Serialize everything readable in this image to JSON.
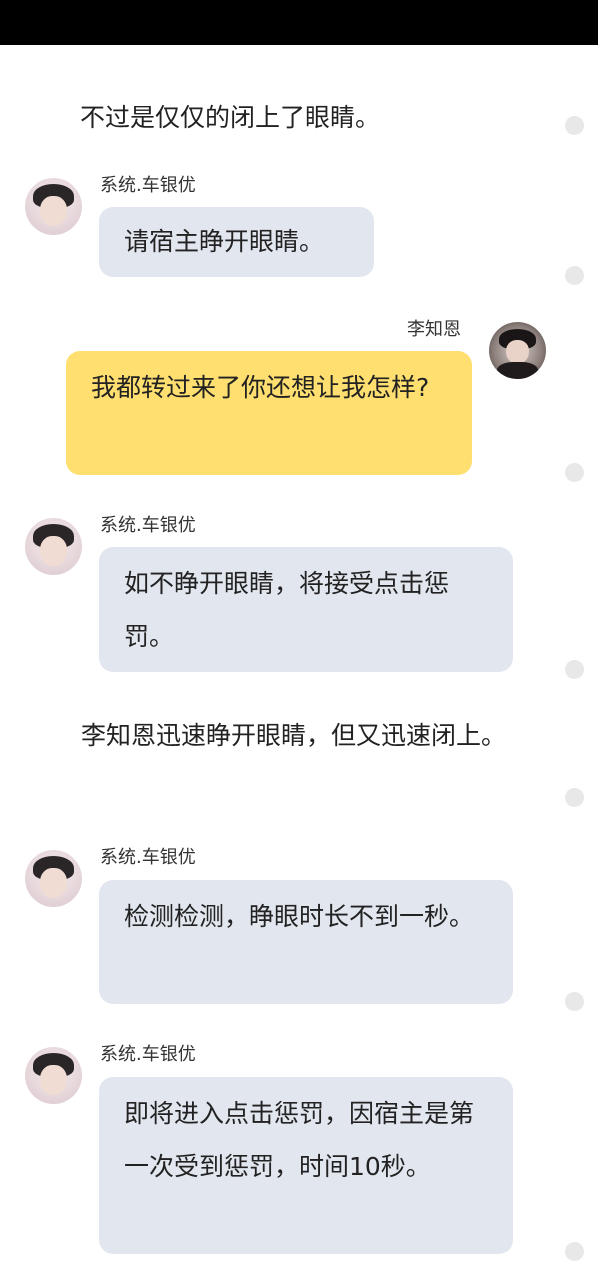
{
  "narrations": [
    "不过是仅仅的闭上了眼睛。",
    "李知恩迅速睁开眼睛，但又迅速闭上。"
  ],
  "messages": [
    {
      "sender": "系统.车银优",
      "text": "请宿主睁开眼睛。",
      "avatar_icon": "boy-portrait-avatar"
    },
    {
      "sender": "李知恩",
      "text": "我都转过来了你还想让我怎样?",
      "avatar_icon": "dark-portrait-avatar"
    },
    {
      "sender": "系统.车银优",
      "text": "如不睁开眼睛，将接受点击惩罚。",
      "avatar_icon": "boy-portrait-avatar"
    },
    {
      "sender": "系统.车银优",
      "text": "检测检测，睁眼时长不到一秒。",
      "avatar_icon": "boy-portrait-avatar"
    },
    {
      "sender": "系统.车银优",
      "text": "即将进入点击惩罚，因宿主是第一次受到惩罚，时间10秒。",
      "avatar_icon": "boy-portrait-avatar"
    }
  ],
  "colors": {
    "system_bubble": "#e2e7ef",
    "user_bubble": "#fedf6f",
    "status_bar": "#000000",
    "side_dot": "#e8e8e8"
  }
}
